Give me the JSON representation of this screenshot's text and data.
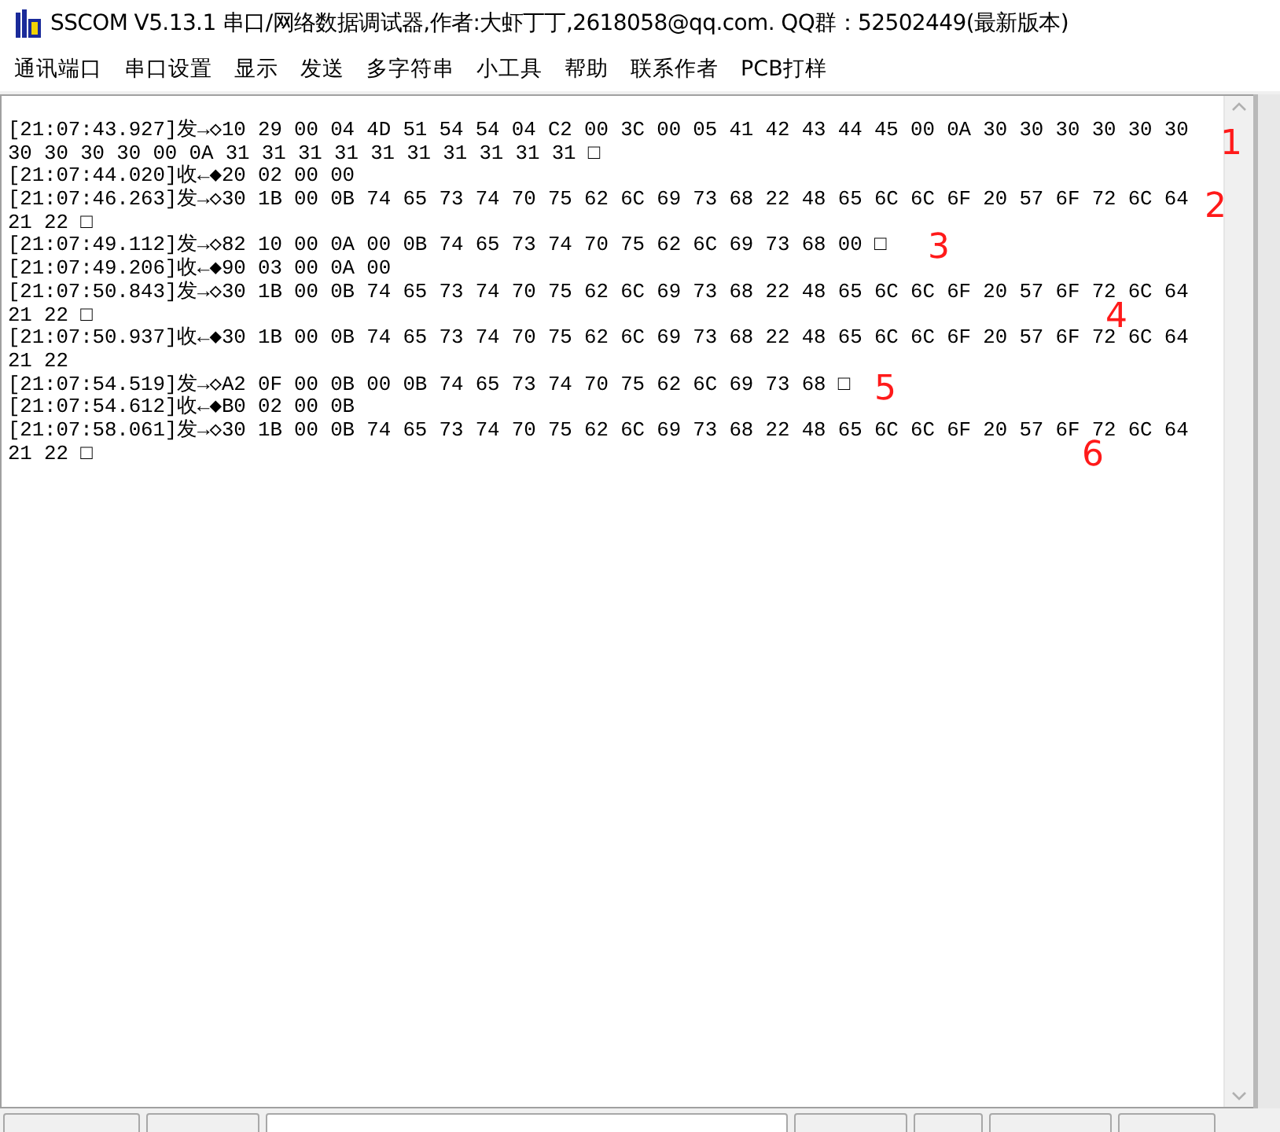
{
  "window": {
    "title": "SSCOM V5.13.1 串口/网络数据调试器,作者:大虾丁丁,2618058@qq.com. QQ群：52502449(最新版本)"
  },
  "menu": [
    "通讯端口",
    "串口设置",
    "显示",
    "发送",
    "多字符串",
    "小工具",
    "帮助",
    "联系作者",
    "PCB打样"
  ],
  "log_lines": [
    "[21:07:43.927]发→◇10 29 00 04 4D 51 54 54 04 C2 00 3C 00 05 41 42 43 44 45 00 0A 30 30 30 30 30 30",
    "30 30 30 30 00 0A 31 31 31 31 31 31 31 31 31 31 □",
    "[21:07:44.020]收←◆20 02 00 00",
    "[21:07:46.263]发→◇30 1B 00 0B 74 65 73 74 70 75 62 6C 69 73 68 22 48 65 6C 6C 6F 20 57 6F 72 6C 64",
    "21 22 □",
    "[21:07:49.112]发→◇82 10 00 0A 00 0B 74 65 73 74 70 75 62 6C 69 73 68 00 □",
    "[21:07:49.206]收←◆90 03 00 0A 00",
    "[21:07:50.843]发→◇30 1B 00 0B 74 65 73 74 70 75 62 6C 69 73 68 22 48 65 6C 6C 6F 20 57 6F 72 6C 64",
    "21 22 □",
    "[21:07:50.937]收←◆30 1B 00 0B 74 65 73 74 70 75 62 6C 69 73 68 22 48 65 6C 6C 6F 20 57 6F 72 6C 64",
    "21 22",
    "[21:07:54.519]发→◇A2 0F 00 0B 00 0B 74 65 73 74 70 75 62 6C 69 73 68 □",
    "[21:07:54.612]收←◆B0 02 00 0B",
    "[21:07:58.061]发→◇30 1B 00 0B 74 65 73 74 70 75 62 6C 69 73 68 22 48 65 6C 6C 6F 20 57 6F 72 6C 64",
    "21 22 □"
  ],
  "annotations": [
    "1",
    "2",
    "3",
    "4",
    "5",
    "6"
  ]
}
